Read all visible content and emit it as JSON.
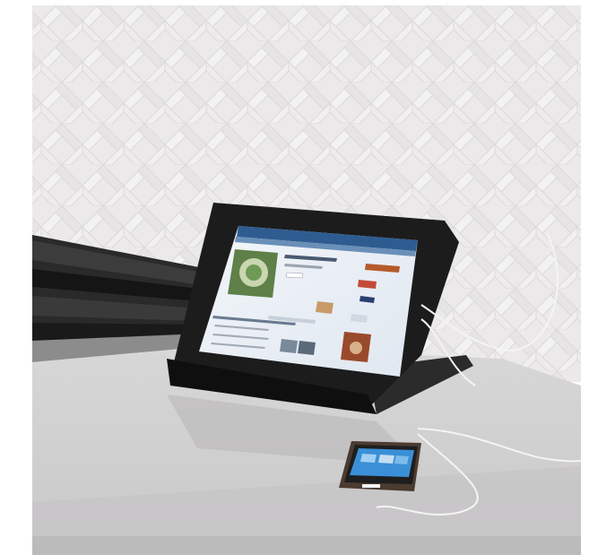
{
  "scene": {
    "backsplash_color": "#e9e6e7",
    "counter_color": "#d3d2d2",
    "stove_color": "#2a2a2a",
    "case_color": "#1c1c1c",
    "screen_bg": "#e8eef4",
    "screen_header": "#2f5c90",
    "phone_screen": "#3b8fd6",
    "cable_color": "#f4f4f4"
  }
}
